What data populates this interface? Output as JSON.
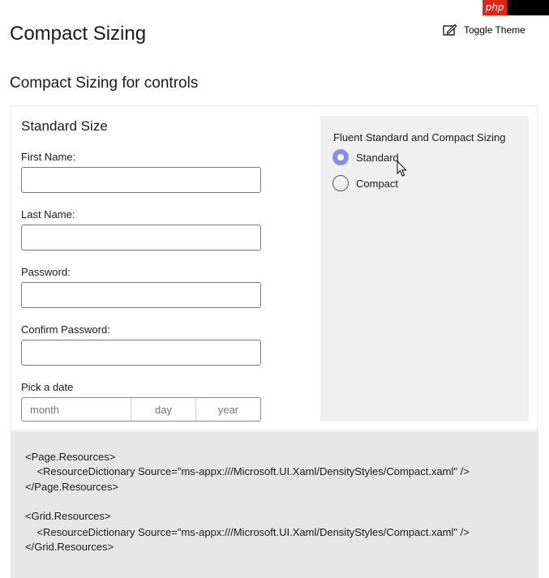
{
  "watermark": {
    "text": "php"
  },
  "header": {
    "title": "Compact Sizing",
    "toggle_theme_label": "Toggle Theme",
    "toggle_theme_icon": "edit-theme-icon"
  },
  "section": {
    "title": "Compact Sizing for controls"
  },
  "form": {
    "title": "Standard Size",
    "first_name_label": "First Name:",
    "first_name_value": "",
    "last_name_label": "Last Name:",
    "last_name_value": "",
    "password_label": "Password:",
    "password_value": "",
    "confirm_password_label": "Confirm Password:",
    "confirm_password_value": "",
    "date_label": "Pick a date",
    "date_month_placeholder": "month",
    "date_day_placeholder": "day",
    "date_year_placeholder": "year"
  },
  "sizing": {
    "heading": "Fluent Standard and Compact Sizing",
    "options": [
      {
        "label": "Standard",
        "checked": true
      },
      {
        "label": "Compact",
        "checked": false
      }
    ],
    "accent_color": "#8c8ce8"
  },
  "code": {
    "lines": [
      "<Page.Resources>",
      "    <ResourceDictionary Source=\"ms-appx:///Microsoft.UI.Xaml/DensityStyles/Compact.xaml\" />",
      "</Page.Resources>",
      "",
      "<Grid.Resources>",
      "    <ResourceDictionary Source=\"ms-appx:///Microsoft.UI.Xaml/DensityStyles/Compact.xaml\" />",
      "</Grid.Resources>"
    ]
  }
}
